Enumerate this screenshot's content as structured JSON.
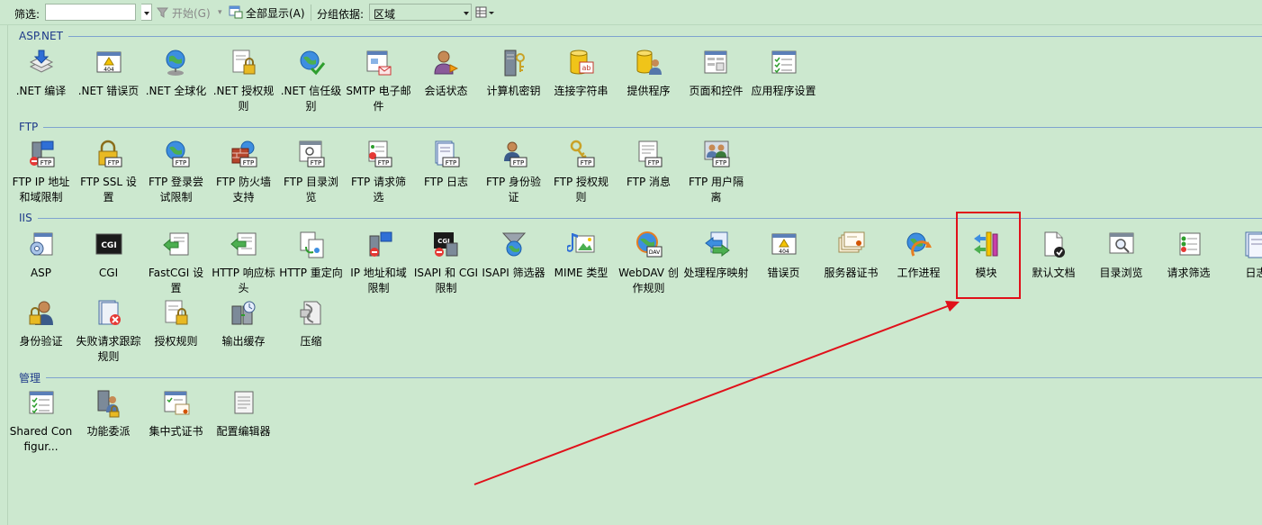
{
  "toolbar": {
    "filter_label": "筛选:",
    "filter_value": "",
    "start_label": "开始(G)",
    "show_all_label": "全部显示(A)",
    "group_by_label": "分组依据:",
    "group_by_value": "区域"
  },
  "groups": [
    {
      "name": "ASP.NET",
      "items": [
        {
          "label": ".NET 编译",
          "icon": "dotnet-compile-icon"
        },
        {
          "label": ".NET 错误页",
          "icon": "error-page-icon"
        },
        {
          "label": ".NET 全球化",
          "icon": "globe-icon"
        },
        {
          "label": ".NET 授权规则",
          "icon": "lock-page-icon"
        },
        {
          "label": ".NET 信任级别",
          "icon": "globe-check-icon"
        },
        {
          "label": "SMTP 电子邮件",
          "icon": "mail-icon"
        },
        {
          "label": "会话状态",
          "icon": "user-icon"
        },
        {
          "label": "计算机密钥",
          "icon": "server-key-icon"
        },
        {
          "label": "连接字符串",
          "icon": "database-icon"
        },
        {
          "label": "提供程序",
          "icon": "provider-icon"
        },
        {
          "label": "页面和控件",
          "icon": "pages-controls-icon"
        },
        {
          "label": "应用程序设置",
          "icon": "app-settings-icon"
        }
      ]
    },
    {
      "name": "FTP",
      "items": [
        {
          "label": "FTP IP 地址和域限制",
          "icon": "ftp-ip-icon"
        },
        {
          "label": "FTP SSL 设置",
          "icon": "ftp-lock-icon"
        },
        {
          "label": "FTP 登录尝试限制",
          "icon": "ftp-globe-icon"
        },
        {
          "label": "FTP 防火墙支持",
          "icon": "ftp-firewall-icon"
        },
        {
          "label": "FTP 目录浏览",
          "icon": "ftp-browse-icon"
        },
        {
          "label": "FTP 请求筛选",
          "icon": "ftp-filter-icon"
        },
        {
          "label": "FTP 日志",
          "icon": "ftp-log-icon"
        },
        {
          "label": "FTP 身份验证",
          "icon": "ftp-user-icon"
        },
        {
          "label": "FTP 授权规则",
          "icon": "ftp-key-icon"
        },
        {
          "label": "FTP 消息",
          "icon": "ftp-message-icon"
        },
        {
          "label": "FTP 用户隔离",
          "icon": "ftp-users-icon"
        }
      ]
    },
    {
      "name": "IIS",
      "items": [
        {
          "label": "ASP",
          "icon": "asp-icon"
        },
        {
          "label": "CGI",
          "icon": "cgi-icon"
        },
        {
          "label": "FastCGI 设置",
          "icon": "fastcgi-icon"
        },
        {
          "label": "HTTP 响应标头",
          "icon": "http-headers-icon"
        },
        {
          "label": "HTTP 重定向",
          "icon": "redirect-icon"
        },
        {
          "label": "IP 地址和域限制",
          "icon": "ip-restrict-icon"
        },
        {
          "label": "ISAPI 和 CGI 限制",
          "icon": "isapi-cgi-icon"
        },
        {
          "label": "ISAPI 筛选器",
          "icon": "isapi-filter-icon"
        },
        {
          "label": "MIME 类型",
          "icon": "mime-icon"
        },
        {
          "label": "WebDAV 创作规则",
          "icon": "webdav-icon"
        },
        {
          "label": "处理程序映射",
          "icon": "handler-mapping-icon"
        },
        {
          "label": "错误页",
          "icon": "error-404-icon"
        },
        {
          "label": "服务器证书",
          "icon": "certificate-icon"
        },
        {
          "label": "工作进程",
          "icon": "worker-process-icon"
        },
        {
          "label": "模块",
          "icon": "modules-icon"
        },
        {
          "label": "默认文档",
          "icon": "default-doc-icon"
        },
        {
          "label": "目录浏览",
          "icon": "dir-browse-icon"
        },
        {
          "label": "请求筛选",
          "icon": "request-filter-icon"
        },
        {
          "label": "日志",
          "icon": "log-icon"
        },
        {
          "label": "身份验证",
          "icon": "auth-icon"
        },
        {
          "label": "失败请求跟踪规则",
          "icon": "failed-request-icon"
        },
        {
          "label": "授权规则",
          "icon": "authz-icon"
        },
        {
          "label": "输出缓存",
          "icon": "output-cache-icon"
        },
        {
          "label": "压缩",
          "icon": "compression-icon"
        }
      ]
    },
    {
      "name": "管理",
      "items": [
        {
          "label": "Shared Configur...",
          "icon": "shared-config-icon"
        },
        {
          "label": "功能委派",
          "icon": "feature-delegation-icon"
        },
        {
          "label": "集中式证书",
          "icon": "central-cert-icon"
        },
        {
          "label": "配置编辑器",
          "icon": "config-editor-icon"
        }
      ]
    }
  ],
  "colors": {
    "background": "#cce8cf",
    "group_header": "#1e3a8a",
    "highlight": "#e0101a"
  }
}
